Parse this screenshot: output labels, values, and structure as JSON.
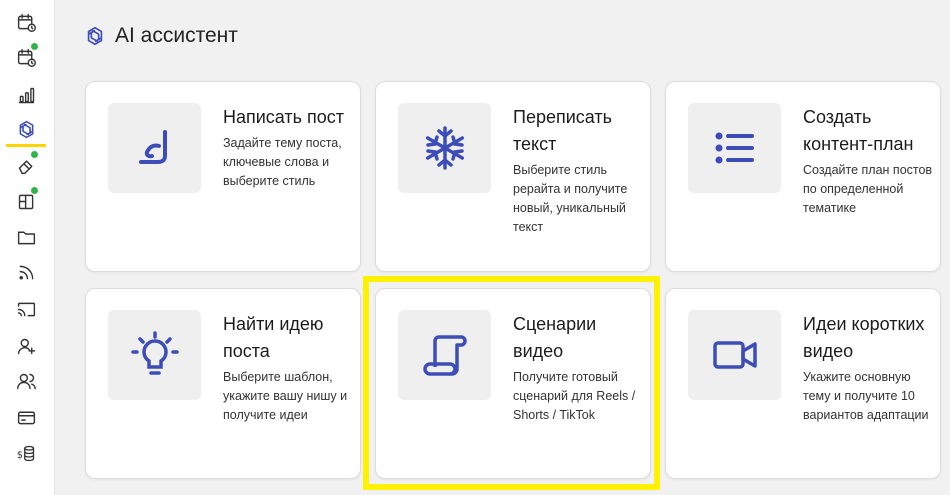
{
  "header": {
    "title": "AI ассистент",
    "icon": "ai-sparkle-icon"
  },
  "sidebar": {
    "items": [
      {
        "icon": "calendar-clock-icon",
        "dot": false
      },
      {
        "icon": "calendar-clock-icon",
        "dot": true
      },
      {
        "icon": "bar-chart-icon",
        "dot": false
      },
      {
        "icon": "ai-sparkle-icon",
        "dot": false,
        "active": true
      },
      {
        "icon": "eraser-icon",
        "dot": true
      },
      {
        "icon": "layout-icon",
        "dot": true
      },
      {
        "icon": "folder-icon",
        "dot": false
      },
      {
        "icon": "rss-icon",
        "dot": false
      },
      {
        "icon": "cast-icon",
        "dot": false
      },
      {
        "icon": "user-plus-icon",
        "dot": false
      },
      {
        "icon": "users-icon",
        "dot": false
      },
      {
        "icon": "credit-card-icon",
        "dot": false
      },
      {
        "icon": "coins-icon",
        "dot": false
      }
    ],
    "dot_color": "#34b34a",
    "active_color": "#ffd400"
  },
  "cards": [
    {
      "title": "Написать пост",
      "desc": "Задайте тему поста, ключевые слова и выберите стиль",
      "icon": "pen-icon"
    },
    {
      "title": "Переписать текст",
      "desc": "Выберите стиль рерайта и получите новый, уникальный текст",
      "icon": "snowflake-icon"
    },
    {
      "title": "Создать контент-план",
      "desc": "Создайте план постов по определенной тематике",
      "icon": "list-icon"
    },
    {
      "title": "Найти идею поста",
      "desc": "Выберите шаблон, укажите вашу нишу и получите идеи",
      "icon": "lightbulb-icon"
    },
    {
      "title": "Сценарии видео",
      "desc": "Получите готовый сценарий для Reels / Shorts / TikTok",
      "icon": "scroll-icon"
    },
    {
      "title": "Идеи коротких видео",
      "desc": "Укажите основную тему и получите 10 вариантов адаптации",
      "icon": "video-camera-icon"
    }
  ],
  "colors": {
    "accent": "#3d4db7",
    "highlight": "#fff200"
  }
}
